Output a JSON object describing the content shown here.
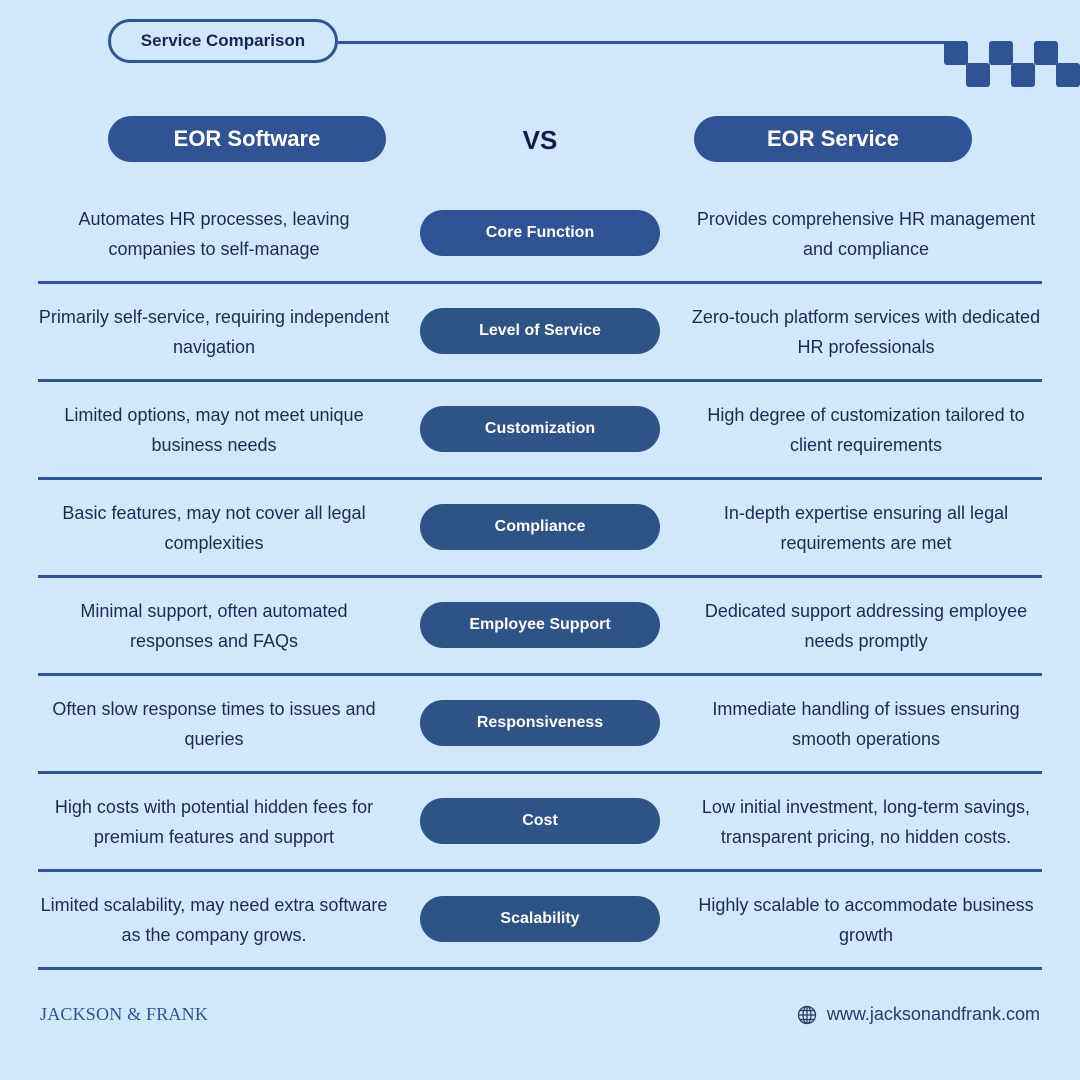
{
  "header": {
    "title": "Service Comparison",
    "left_label": "EOR Software",
    "vs_label": "VS",
    "right_label": "EOR Service"
  },
  "colors": {
    "background": "#cfe8fc",
    "accent": "#2f5394",
    "pill": "#2e5385",
    "text": "#1e2a50"
  },
  "rows": [
    {
      "category": "Core Function",
      "left": "Automates HR processes, leaving companies to self-manage",
      "right": "Provides comprehensive HR management and compliance"
    },
    {
      "category": "Level of Service",
      "left": "Primarily self-service, requiring independent navigation",
      "right": "Zero-touch platform services with dedicated HR professionals"
    },
    {
      "category": "Customization",
      "left": "Limited options, may not meet unique business needs",
      "right": "High degree of customization tailored to client requirements"
    },
    {
      "category": "Compliance",
      "left": "Basic features, may not cover all legal complexities",
      "right": "In-depth expertise ensuring all legal requirements are met"
    },
    {
      "category": "Employee Support",
      "left": "Minimal support, often automated responses and FAQs",
      "right": "Dedicated support addressing employee needs promptly"
    },
    {
      "category": "Responsiveness",
      "left": "Often slow response times to issues and queries",
      "right": "Immediate handling of issues ensuring smooth operations"
    },
    {
      "category": "Cost",
      "left": "High costs with potential hidden fees for premium features and support",
      "right": "Low initial investment, long-term savings, transparent pricing, no hidden costs."
    },
    {
      "category": "Scalability",
      "left": "Limited scalability, may need extra software as the company grows.",
      "right": "Highly scalable to accommodate business growth"
    }
  ],
  "footer": {
    "brand": "JACKSON & FRANK",
    "website_icon": "globe-icon",
    "website": "www.jacksonandfrank.com"
  }
}
